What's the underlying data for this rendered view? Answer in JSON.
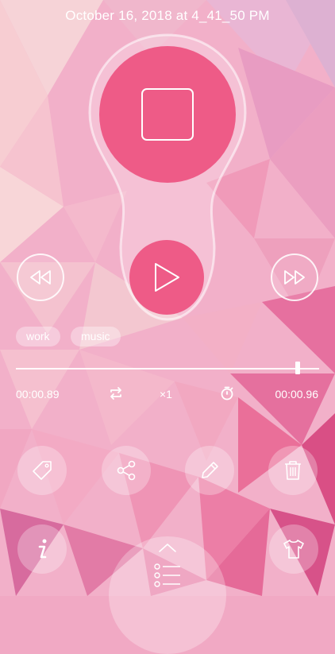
{
  "recording": {
    "title": "October 16, 2018 at 4_41_50 PM"
  },
  "tags": [
    "work",
    "music"
  ],
  "playback": {
    "elapsed": "00:00.89",
    "total": "00:00.96",
    "speed": "×1",
    "progress_fraction": 0.93
  },
  "icons": {
    "record": "stop-square-icon",
    "play": "play-icon",
    "rewind": "rewind-icon",
    "fast_forward": "fast-forward-icon",
    "repeat": "repeat-icon",
    "timer": "timer-icon",
    "tag": "tag-icon",
    "share": "share-icon",
    "edit": "pencil-icon",
    "delete": "trash-icon",
    "info": "info-icon",
    "theme": "tshirt-icon",
    "drawer": "chevron-up-icon",
    "list": "list-icon"
  },
  "colors": {
    "accent": "#ee5b87",
    "background": "#f1a9c4",
    "foreground": "#ffffff"
  }
}
